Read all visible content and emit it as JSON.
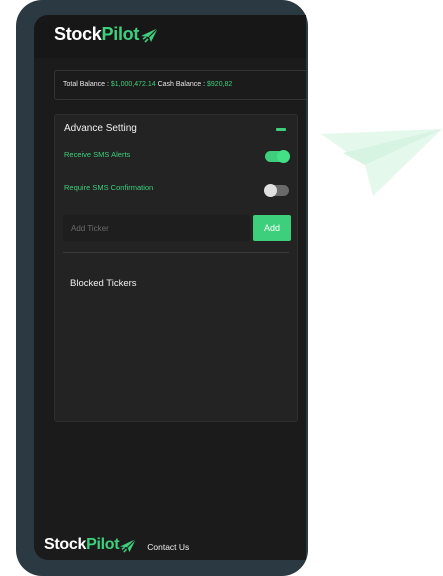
{
  "brand": {
    "stock": "Stock",
    "pilot": "Pilot"
  },
  "balance": {
    "total_label": "Total Balance : ",
    "total_value": "$1,000,472.14",
    "cash_label": " Cash Balance : ",
    "cash_value": "$920,82"
  },
  "advance_setting": {
    "title": "Advance Setting",
    "sms_alerts": {
      "label": "Receive SMS Alerts",
      "on": true
    },
    "sms_confirmation": {
      "label": "Require SMS Confirmation",
      "on": false
    },
    "ticker_input": {
      "placeholder": "Add Ticker",
      "value": ""
    },
    "add_label": "Add",
    "blocked_title": "Blocked Tickers"
  },
  "footer": {
    "contact_label": "Contact Us"
  },
  "colors": {
    "accent": "#3ecf7c",
    "background": "#1b1b1b",
    "card": "#232323",
    "phone_frame": "#2b3a42"
  },
  "icons": {
    "brand_icon": "paper-plane-icon",
    "decoration": "paper-plane-icon"
  }
}
